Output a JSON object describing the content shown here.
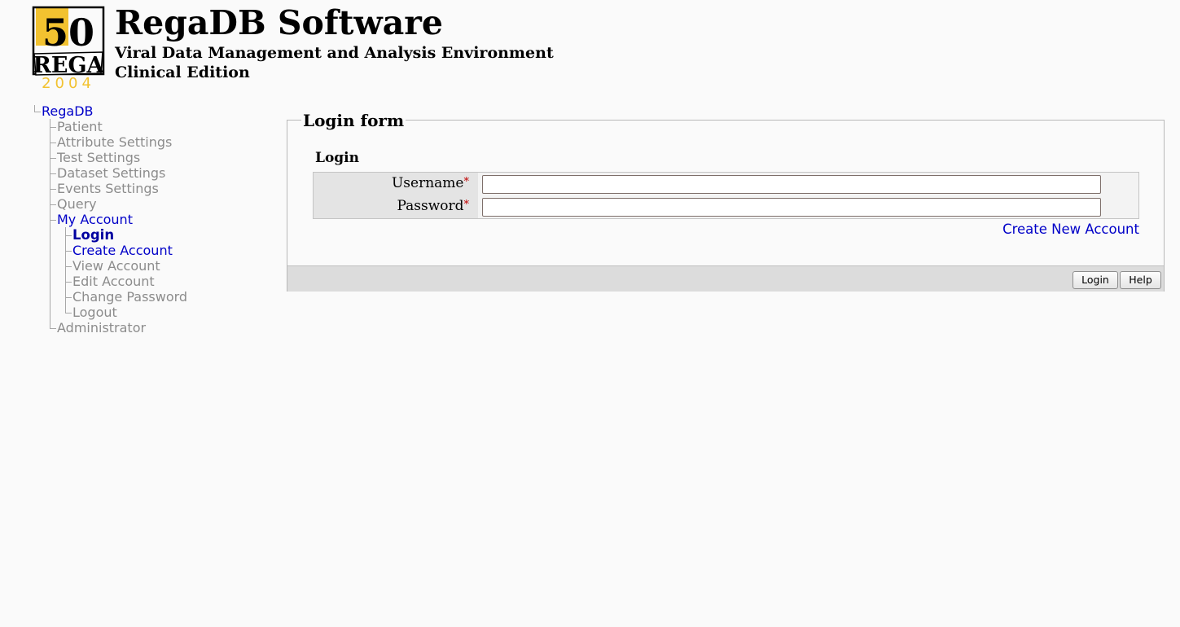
{
  "header": {
    "title": "RegaDB Software",
    "subtitle_line1": "Viral Data Management and Analysis Environment",
    "subtitle_line2": "Clinical Edition",
    "logo": {
      "text_number": "50",
      "text_name": "REGA",
      "text_year": "2004",
      "accent_color": "#f2c230"
    }
  },
  "tree": {
    "root": "RegaDB",
    "items": [
      {
        "label": "Patient",
        "state": "disabled"
      },
      {
        "label": "Attribute Settings",
        "state": "disabled"
      },
      {
        "label": "Test Settings",
        "state": "disabled"
      },
      {
        "label": "Dataset Settings",
        "state": "disabled"
      },
      {
        "label": "Events Settings",
        "state": "disabled"
      },
      {
        "label": "Query",
        "state": "disabled"
      },
      {
        "label": "My Account",
        "state": "link",
        "children": [
          {
            "label": "Login",
            "state": "selected"
          },
          {
            "label": "Create Account",
            "state": "link"
          },
          {
            "label": "View Account",
            "state": "disabled"
          },
          {
            "label": "Edit Account",
            "state": "disabled"
          },
          {
            "label": "Change Password",
            "state": "disabled"
          },
          {
            "label": "Logout",
            "state": "disabled"
          }
        ]
      },
      {
        "label": "Administrator",
        "state": "disabled"
      }
    ]
  },
  "form": {
    "legend": "Login form",
    "group_title": "Login",
    "fields": [
      {
        "label": "Username",
        "required_marker": "*",
        "value": ""
      },
      {
        "label": "Password",
        "required_marker": "*",
        "value": ""
      }
    ],
    "create_account_link": "Create New Account",
    "buttons": {
      "login": "Login",
      "help": "Help"
    }
  },
  "colors": {
    "link": "#0000c8",
    "disabled": "#8c8c8c",
    "required": "#c00000",
    "page_background": "#fafafa"
  }
}
